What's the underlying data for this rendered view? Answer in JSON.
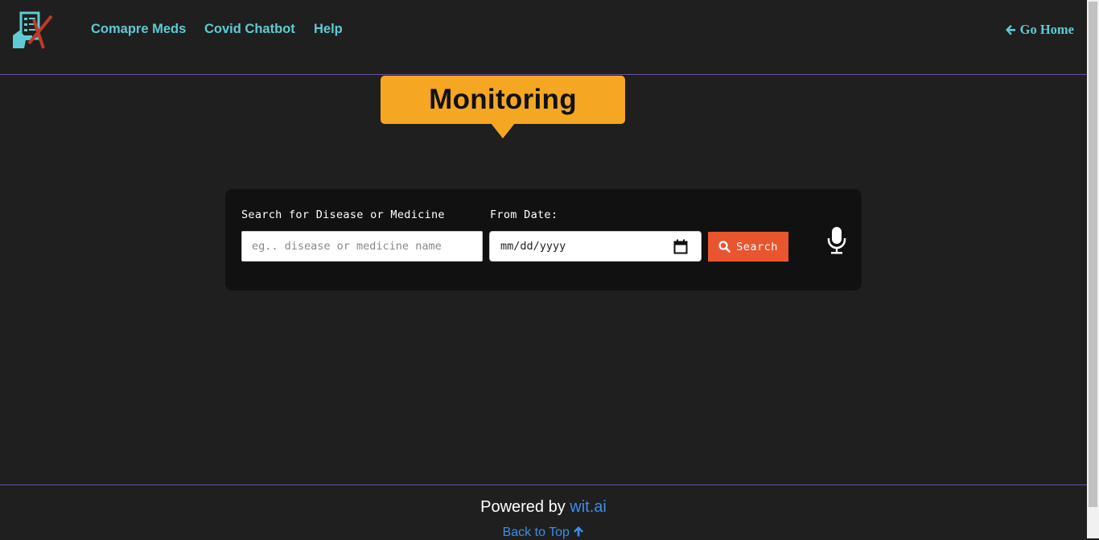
{
  "nav": {
    "links": [
      "Comapre Meds",
      "Covid Chatbot",
      "Help"
    ],
    "go_home": "Go Home"
  },
  "badge": {
    "text": "Monitoring"
  },
  "search": {
    "disease_label": "Search for Disease or Medicine",
    "disease_placeholder": "eg.. disease or medicine name",
    "date_label": "From Date:",
    "date_placeholder": "mm/dd/yyyy",
    "button_label": "Search"
  },
  "footer": {
    "powered_prefix": "Powered by",
    "powered_link": "wit.ai",
    "back_to_top": "Back to Top"
  },
  "colors": {
    "background": "#1f1f1f",
    "nav_link": "#5ecbd4",
    "badge": "#f5a623",
    "search_button": "#e8552f",
    "footer_link": "#3b8eea",
    "divider": "#6b4fa0"
  },
  "icons": [
    "app-logo-icon",
    "arrow-left-icon",
    "search-icon",
    "calendar-icon",
    "microphone-icon",
    "arrow-up-icon"
  ]
}
